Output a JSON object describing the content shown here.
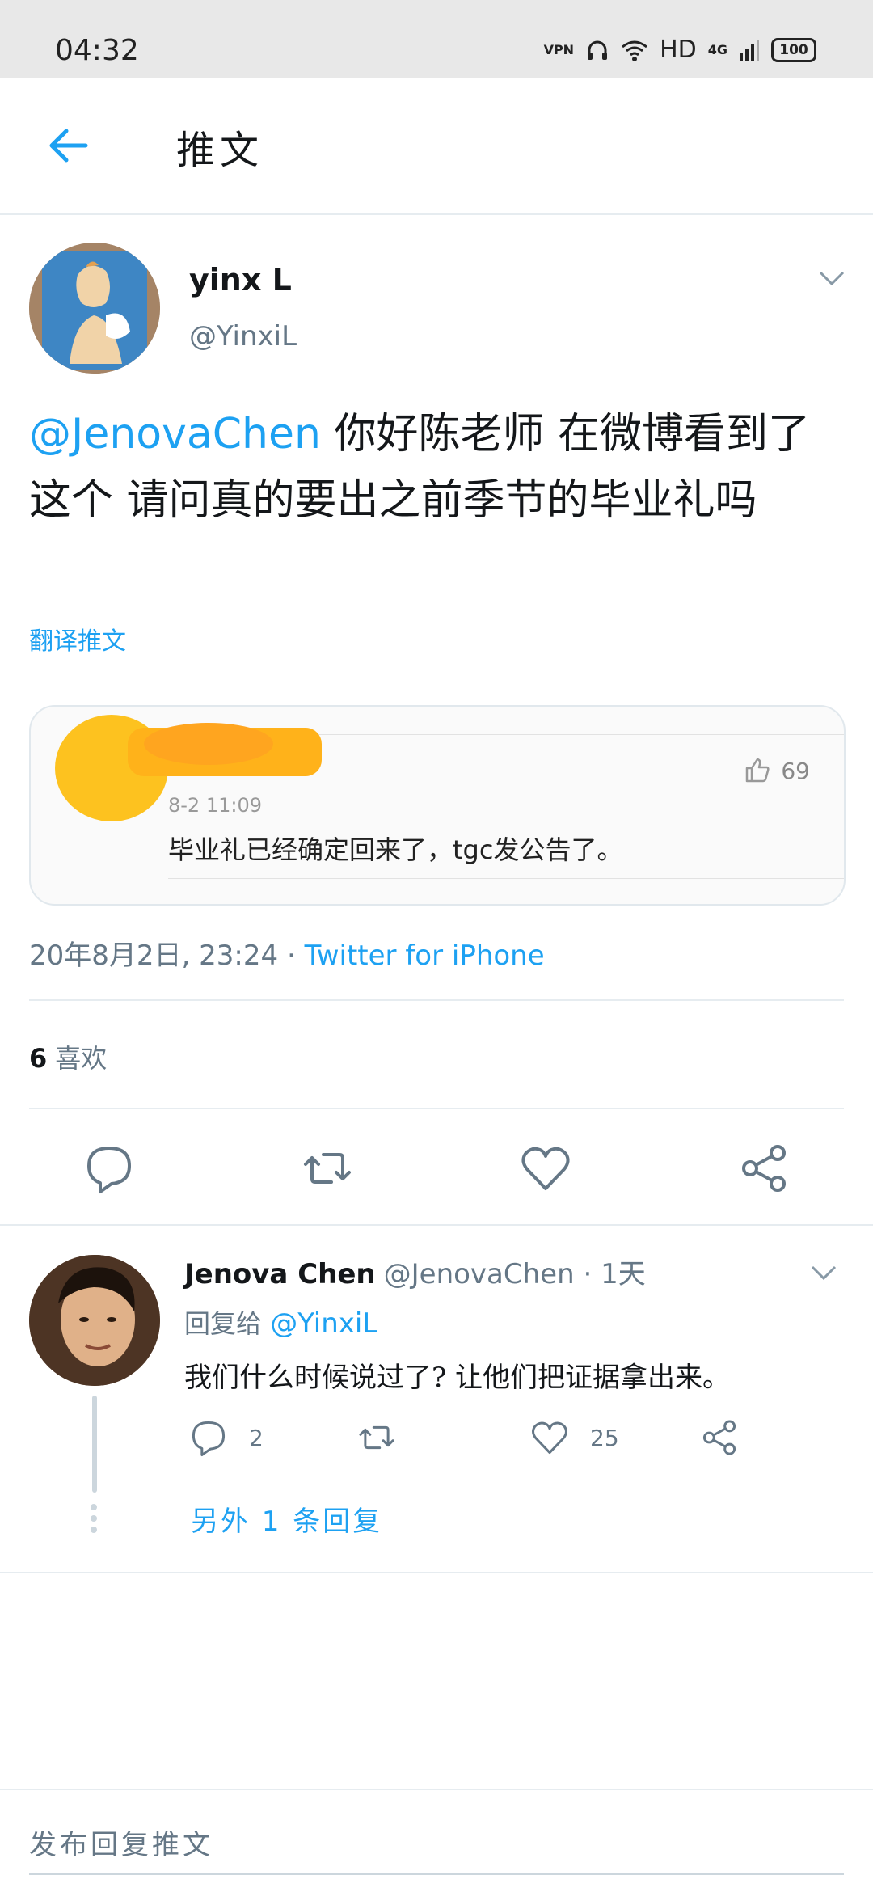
{
  "status_bar": {
    "time": "04:32",
    "vpn": "VPN",
    "hd": "HD",
    "network": "4G",
    "battery": "100"
  },
  "header": {
    "title": "推文"
  },
  "tweet": {
    "author_name": "yinx L",
    "author_handle": "@YinxiL",
    "mention": "@JenovaChen",
    "text": " 你好陈老师 在微博看到了这个 请问真的要出之前季节的毕业礼吗",
    "translate_label": "翻译推文",
    "media": {
      "like_count": "69",
      "date": "8-2 11:09",
      "comment": "毕业礼已经确定回来了，tgc发公告了。"
    },
    "timestamp": "20年8月2日, 23:24",
    "separator": "·",
    "source": "Twitter for iPhone",
    "likes_count": "6",
    "likes_label": "喜欢"
  },
  "reply": {
    "author_name": "Jenova Chen",
    "author_handle": "@JenovaChen",
    "time": "· 1天",
    "reply_to_label": "回复给",
    "reply_to_handle": "@YinxiL",
    "text": "我们什么时候说过了? 让他们把证据拿出来。",
    "reply_count": "2",
    "like_count": "25",
    "more_replies": "另外 1 条回复"
  },
  "composer": {
    "placeholder": "发布回复推文"
  },
  "colors": {
    "accent": "#1da1f2",
    "secondary_text": "#657786",
    "divider": "#e6ecf0"
  }
}
